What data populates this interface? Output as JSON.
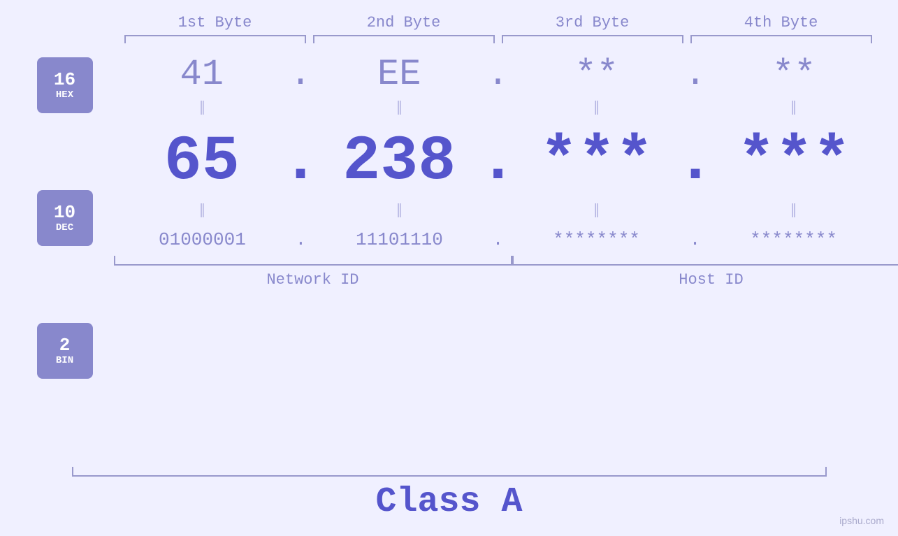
{
  "headers": {
    "byte1": "1st Byte",
    "byte2": "2nd Byte",
    "byte3": "3rd Byte",
    "byte4": "4th Byte"
  },
  "badges": {
    "hex": {
      "number": "16",
      "label": "HEX"
    },
    "dec": {
      "number": "10",
      "label": "DEC"
    },
    "bin": {
      "number": "2",
      "label": "BIN"
    }
  },
  "hex_row": {
    "val1": "41",
    "val2": "EE",
    "val3": "**",
    "val4": "**",
    "dot": "."
  },
  "dec_row": {
    "val1": "65",
    "val2": "238",
    "val3": "***",
    "val4": "***",
    "dot": "."
  },
  "bin_row": {
    "val1": "01000001",
    "val2": "11101110",
    "val3": "********",
    "val4": "********",
    "dot": "."
  },
  "labels": {
    "network_id": "Network ID",
    "host_id": "Host ID",
    "class": "Class A"
  },
  "watermark": "ipshu.com",
  "colors": {
    "accent_light": "#8888cc",
    "accent_dark": "#5555cc",
    "bg": "#f0f0ff"
  }
}
